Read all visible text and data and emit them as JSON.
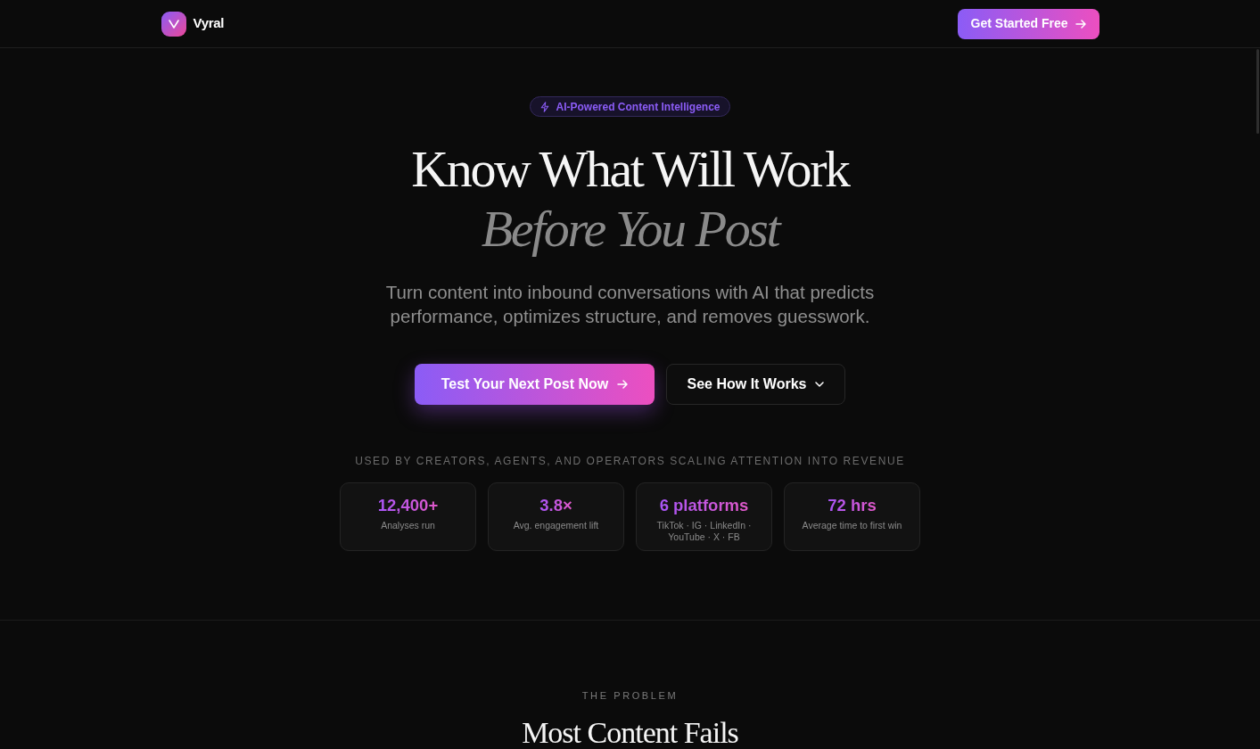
{
  "navbar": {
    "brand": "Vyral",
    "cta": {
      "label": "Get Started Free"
    }
  },
  "hero": {
    "badge": "AI-Powered Content Intelligence",
    "headline": "Know What Will Work",
    "headline_emphasis": "Before You Post",
    "subtitle": "Turn content into inbound conversations with AI that predicts performance, optimizes structure, and removes guesswork.",
    "buttons": [
      {
        "label": "Test Your Next Post Now",
        "kind": "primary"
      },
      {
        "label": "See How It Works",
        "kind": "secondary"
      }
    ],
    "tagline": "USED BY CREATORS, AGENTS, AND OPERATORS SCALING ATTENTION INTO REVENUE",
    "stats": [
      {
        "value": "12,400+",
        "label": "Analyses run"
      },
      {
        "value": "3.8×",
        "label": "Avg. engagement lift"
      },
      {
        "value": "6 platforms",
        "label": "TikTok · IG · LinkedIn · YouTube · X · FB"
      },
      {
        "value": "72 hrs",
        "label": "Average time to first win"
      }
    ]
  },
  "problem_section": {
    "eyebrow": "THE PROBLEM",
    "title": "Most Content Fails"
  }
}
